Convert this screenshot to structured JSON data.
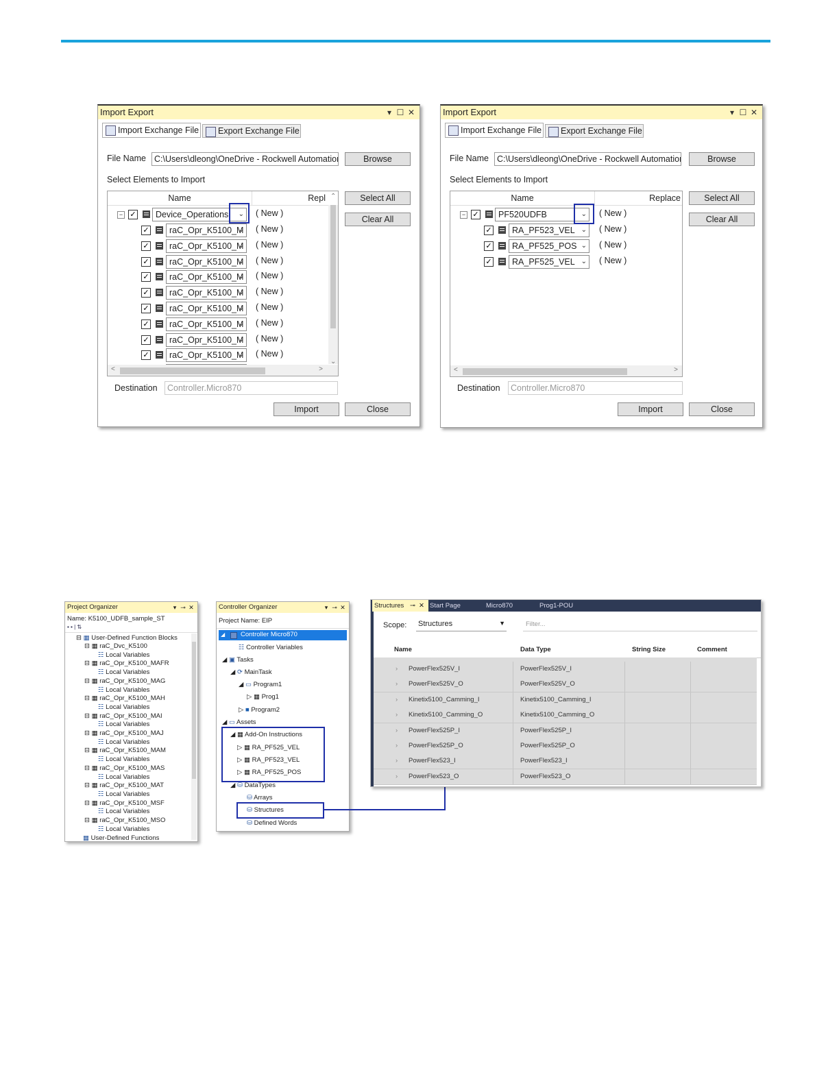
{
  "dialog_common": {
    "title": "Import Export",
    "controls": [
      "▾",
      "☐",
      "✕"
    ],
    "tab_import": "Import Exchange File",
    "tab_export": "Export Exchange File",
    "file_name_label": "File Name",
    "file_name_value": "C:\\Users\\dleong\\OneDrive - Rockwell Automation",
    "browse": "Browse",
    "select_elements_label": "Select Elements to Import",
    "select_all": "Select All",
    "clear_all": "Clear All",
    "col_name": "Name",
    "destination_label": "Destination",
    "destination_value": "Controller.Micro870",
    "import": "Import",
    "close": "Close",
    "new_text": "( New )"
  },
  "dialog_left": {
    "col_replace": "Repl",
    "root": "Device_Operations",
    "children": [
      "raC_Opr_K5100_M",
      "raC_Opr_K5100_M",
      "raC_Opr_K5100_M",
      "raC_Opr_K5100_M",
      "raC_Opr_K5100_M",
      "raC_Opr_K5100_M",
      "raC_Opr_K5100_M",
      "raC_Opr_K5100_M",
      "raC_Opr_K5100_M",
      "raC_Opr_K5100_M"
    ]
  },
  "dialog_right": {
    "col_replace": "Replace",
    "root": "PF520UDFB",
    "children": [
      "RA_PF523_VEL",
      "RA_PF525_POS",
      "RA_PF525_VEL"
    ]
  },
  "project_organizer": {
    "title": "Project Organizer",
    "name_line": "Name:  K5100_UDFB_sample_ST",
    "root": "User-Defined Function Blocks",
    "blocks": [
      "raC_Dvc_K5100",
      "raC_Opr_K5100_MAFR",
      "raC_Opr_K5100_MAG",
      "raC_Opr_K5100_MAH",
      "raC_Opr_K5100_MAI",
      "raC_Opr_K5100_MAJ",
      "raC_Opr_K5100_MAM",
      "raC_Opr_K5100_MAS",
      "raC_Opr_K5100_MAT",
      "raC_Opr_K5100_MSF",
      "raC_Opr_K5100_MSO"
    ],
    "local_vars": "Local Variables",
    "footer": "User-Defined Functions"
  },
  "controller_organizer": {
    "title": "Controller Organizer",
    "project_name": "Project Name:  EIP",
    "controller": "Controller Micro870",
    "controller_variables": "Controller Variables",
    "tasks": "Tasks",
    "main_task": "MainTask",
    "program1": "Program1",
    "prog1": "Prog1",
    "program2": "Program2",
    "assets": "Assets",
    "aoi": "Add-On Instructions",
    "aoi_items": [
      "RA_PF525_VEL",
      "RA_PF523_VEL",
      "RA_PF525_POS"
    ],
    "datatypes": "DataTypes",
    "arrays": "Arrays",
    "structures": "Structures",
    "defined_words": "Defined Words"
  },
  "structures_panel": {
    "tabs": [
      "Structures",
      "Start Page",
      "Micro870",
      "Prog1-POU"
    ],
    "tab_controls": [
      "⊸",
      "✕"
    ],
    "scope_label": "Scope:",
    "scope_value": "Structures",
    "filter_placeholder": "Filter...",
    "columns": [
      "Name",
      "Data Type",
      "String Size",
      "Comment"
    ],
    "rows": [
      {
        "name": "PowerFlex525V_I",
        "type": "PowerFlex525V_I"
      },
      {
        "name": "PowerFlex525V_O",
        "type": "PowerFlex525V_O"
      },
      {
        "name": "Kinetix5100_Camming_I",
        "type": "Kinetix5100_Camming_I"
      },
      {
        "name": "Kinetix5100_Camming_O",
        "type": "Kinetix5100_Camming_O"
      },
      {
        "name": "PowerFlex525P_I",
        "type": "PowerFlex525P_I"
      },
      {
        "name": "PowerFlex525P_O",
        "type": "PowerFlex525P_O"
      },
      {
        "name": "PowerFlex523_I",
        "type": "PowerFlex523_I"
      },
      {
        "name": "PowerFlex523_O",
        "type": "PowerFlex523_O"
      }
    ]
  }
}
